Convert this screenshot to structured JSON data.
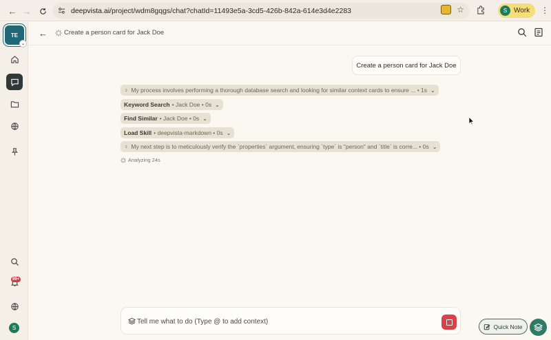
{
  "browser": {
    "url_domain": "deepvista.ai",
    "url_path": "/project/wdm8gqgs/chat?chatId=11493e5a-3cd5-426b-842a-614e3d4e2283",
    "profile_label": "Work",
    "profile_initial": "S"
  },
  "rail": {
    "workspace_initials": "TE",
    "notification_count": "99+",
    "user_initial": "S"
  },
  "header": {
    "title": "Create a person card for Jack Doe"
  },
  "chat": {
    "user_message": "Create a person card for Jack Doe",
    "steps": [
      {
        "bold": "",
        "text": "My process involves performing a thorough database search and looking for similar context cards to ensure ...",
        "time": "• 1s",
        "bulb": true
      },
      {
        "bold": "Keyword Search",
        "text": "• Jack Doe",
        "time": "• 0s",
        "bulb": false
      },
      {
        "bold": "Find Similar",
        "text": "• Jack Doe",
        "time": "• 0s",
        "bulb": false
      },
      {
        "bold": "Load Skill",
        "text": "• deepvista-markdown",
        "time": "• 0s",
        "bulb": false
      },
      {
        "bold": "",
        "text": "My next step is to meticulously verify the `properties` argument, ensuring `type` is \"person\" and `title` is corre...",
        "time": "• 0s",
        "bulb": true
      }
    ],
    "status": "Analyzing 24s"
  },
  "composer": {
    "placeholder": "Tell me what to do (Type @ to add context)"
  },
  "quick_note": {
    "label": "Quick Note"
  }
}
